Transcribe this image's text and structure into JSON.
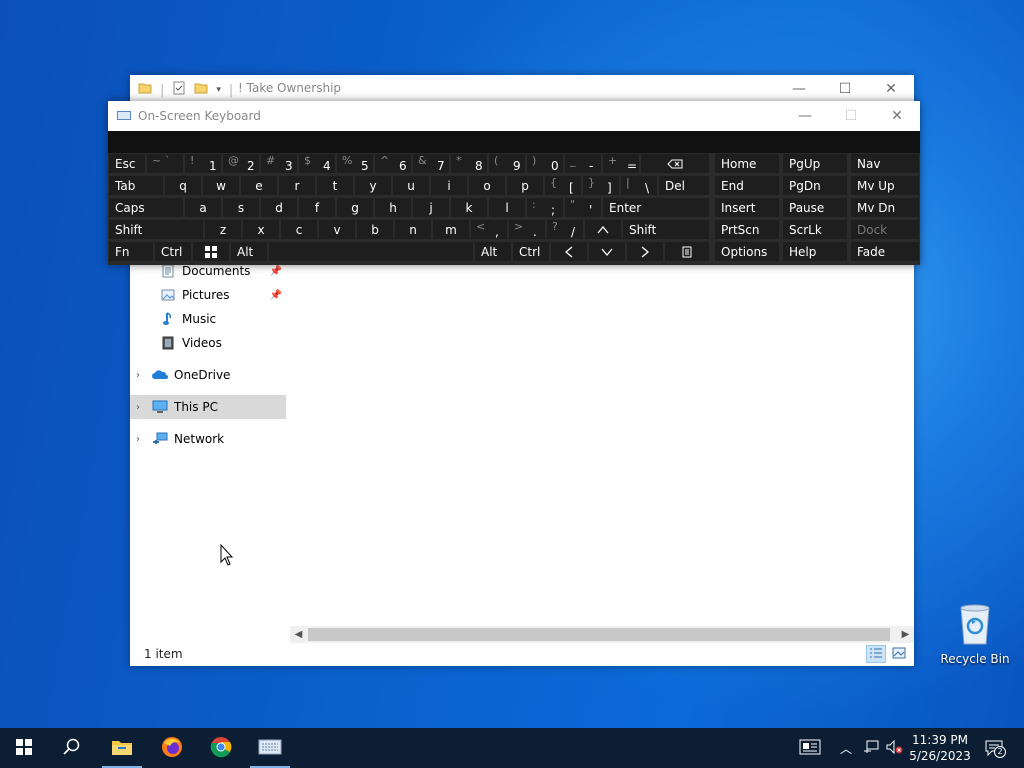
{
  "colors": {
    "desktop": "#0a5fc8",
    "taskbar": "#0b1e33",
    "osk_bg": "#2b2b2b",
    "osk_key": "#1e1e1e",
    "osk_text": "#ffffff",
    "selection": "#d9d9d9",
    "accent": "#7fb3e8"
  },
  "desktop": {
    "recycle_bin_label": "Recycle Bin"
  },
  "explorer": {
    "title": "! Take Ownership",
    "qat_icons": [
      "folder-icon",
      "properties-icon",
      "new-folder-icon",
      "dropdown-icon"
    ],
    "nav_items": [
      {
        "label": "Documents",
        "icon": "documents-icon",
        "pinned": true
      },
      {
        "label": "Pictures",
        "icon": "pictures-icon",
        "pinned": true
      },
      {
        "label": "Music",
        "icon": "music-icon",
        "pinned": false
      },
      {
        "label": "Videos",
        "icon": "videos-icon",
        "pinned": false
      },
      {
        "label": "OneDrive",
        "icon": "onedrive-icon",
        "expandable": true
      },
      {
        "label": "This PC",
        "icon": "this-pc-icon",
        "expandable": true,
        "selected": true
      },
      {
        "label": "Network",
        "icon": "network-icon",
        "expandable": true
      }
    ],
    "status_text": "1 item",
    "view_modes": [
      "details-view-icon",
      "large-icons-view-icon"
    ],
    "active_view": "details-view-icon"
  },
  "osk": {
    "title": "On-Screen Keyboard",
    "rows": [
      [
        {
          "p": "Esc"
        },
        {
          "s": "~ `",
          "p": ""
        },
        {
          "s": "!",
          "p": "1"
        },
        {
          "s": "@",
          "p": "2"
        },
        {
          "s": "#",
          "p": "3"
        },
        {
          "s": "$",
          "p": "4"
        },
        {
          "s": "%",
          "p": "5"
        },
        {
          "s": "^",
          "p": "6"
        },
        {
          "s": "&",
          "p": "7"
        },
        {
          "s": "*",
          "p": "8"
        },
        {
          "s": "(",
          "p": "9"
        },
        {
          "s": ")",
          "p": "0"
        },
        {
          "s": "_",
          "p": "-"
        },
        {
          "s": "+",
          "p": "="
        },
        {
          "p": "",
          "icon": "backspace-icon"
        }
      ],
      [
        {
          "p": "Tab"
        },
        {
          "p": "q"
        },
        {
          "p": "w"
        },
        {
          "p": "e"
        },
        {
          "p": "r"
        },
        {
          "p": "t"
        },
        {
          "p": "y"
        },
        {
          "p": "u"
        },
        {
          "p": "i"
        },
        {
          "p": "o"
        },
        {
          "p": "p"
        },
        {
          "s": "{",
          "p": "["
        },
        {
          "s": "}",
          "p": "]"
        },
        {
          "s": "|",
          "p": "\\"
        },
        {
          "p": "Del"
        }
      ],
      [
        {
          "p": "Caps"
        },
        {
          "p": "a"
        },
        {
          "p": "s"
        },
        {
          "p": "d"
        },
        {
          "p": "f"
        },
        {
          "p": "g"
        },
        {
          "p": "h"
        },
        {
          "p": "j"
        },
        {
          "p": "k"
        },
        {
          "p": "l"
        },
        {
          "s": ":",
          "p": ";"
        },
        {
          "s": "\"",
          "p": "'"
        },
        {
          "p": "Enter"
        }
      ],
      [
        {
          "p": "Shift"
        },
        {
          "p": "z"
        },
        {
          "p": "x"
        },
        {
          "p": "c"
        },
        {
          "p": "v"
        },
        {
          "p": "b"
        },
        {
          "p": "n"
        },
        {
          "p": "m"
        },
        {
          "s": "<",
          "p": ","
        },
        {
          "s": ">",
          "p": "."
        },
        {
          "s": "?",
          "p": "/"
        },
        {
          "p": "",
          "icon": "up-arrow-icon"
        },
        {
          "p": "Shift"
        }
      ],
      [
        {
          "p": "Fn"
        },
        {
          "p": "Ctrl"
        },
        {
          "p": "",
          "icon": "windows-logo-icon"
        },
        {
          "p": "Alt"
        },
        {
          "p": ""
        },
        {
          "p": "Alt"
        },
        {
          "p": "Ctrl"
        },
        {
          "p": "",
          "icon": "left-arrow-icon"
        },
        {
          "p": "",
          "icon": "down-arrow-icon"
        },
        {
          "p": "",
          "icon": "right-arrow-icon"
        },
        {
          "p": "",
          "icon": "menu-key-icon"
        }
      ]
    ],
    "nav_keys": [
      [
        "Home",
        "PgUp",
        "Nav"
      ],
      [
        "End",
        "PgDn",
        "Mv Up"
      ],
      [
        "Insert",
        "Pause",
        "Mv Dn"
      ],
      [
        "PrtScn",
        "ScrLk",
        "Dock"
      ],
      [
        "Options",
        "Help",
        "Fade"
      ]
    ]
  },
  "taskbar": {
    "apps": [
      "start-icon",
      "search-icon",
      "file-explorer-icon",
      "firefox-icon",
      "chrome-icon",
      "on-screen-keyboard-icon"
    ],
    "time": "11:39 PM",
    "date": "5/26/2023",
    "notification_count": "2"
  }
}
